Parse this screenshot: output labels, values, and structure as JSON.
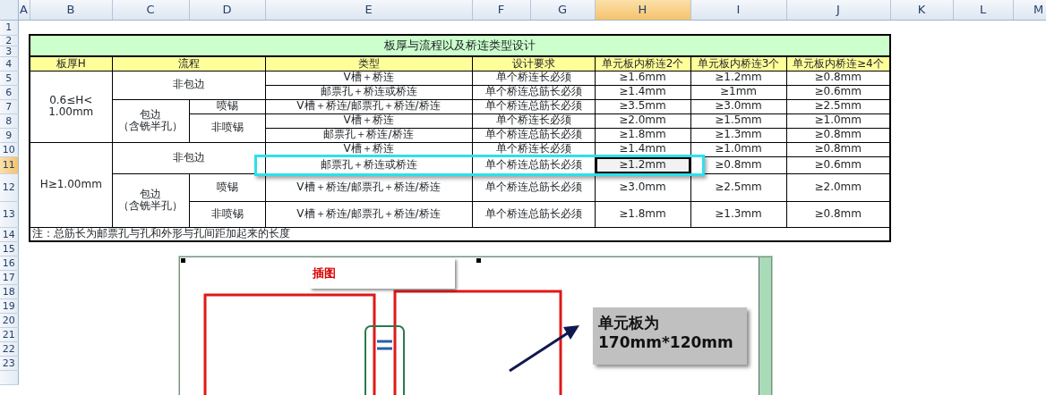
{
  "columns": [
    {
      "label": "A",
      "selected": false
    },
    {
      "label": "B",
      "selected": false
    },
    {
      "label": "C",
      "selected": false
    },
    {
      "label": "D",
      "selected": false
    },
    {
      "label": "E",
      "selected": false
    },
    {
      "label": "F",
      "selected": false
    },
    {
      "label": "G",
      "selected": false
    },
    {
      "label": "H",
      "selected": true
    },
    {
      "label": "I",
      "selected": false
    },
    {
      "label": "J",
      "selected": false
    },
    {
      "label": "K",
      "selected": false
    },
    {
      "label": "L",
      "selected": false
    },
    {
      "label": "M",
      "selected": false
    }
  ],
  "row_numbers": [
    {
      "label": "1",
      "selected": false
    },
    {
      "label": "2",
      "selected": false
    },
    {
      "label": "3",
      "selected": false
    },
    {
      "label": "4",
      "selected": false
    },
    {
      "label": "5",
      "selected": false
    },
    {
      "label": "6",
      "selected": false
    },
    {
      "label": "7",
      "selected": false
    },
    {
      "label": "8",
      "selected": false
    },
    {
      "label": "9",
      "selected": false
    },
    {
      "label": "10",
      "selected": false
    },
    {
      "label": "11",
      "selected": true
    },
    {
      "label": "12",
      "selected": false
    },
    {
      "label": "13",
      "selected": false
    },
    {
      "label": "14",
      "selected": false
    },
    {
      "label": "15",
      "selected": false
    },
    {
      "label": "16",
      "selected": false
    },
    {
      "label": "17",
      "selected": false
    },
    {
      "label": "18",
      "selected": false
    },
    {
      "label": "19",
      "selected": false
    },
    {
      "label": "20",
      "selected": false
    },
    {
      "label": "21",
      "selected": false
    },
    {
      "label": "22",
      "selected": false
    },
    {
      "label": "23",
      "selected": false
    }
  ],
  "table": {
    "title": "板厚与流程以及桥连类型设计",
    "headers": [
      "板厚H",
      "流程",
      "类型",
      "设计要求",
      "单元板内桥连2个",
      "单元板内桥连3个",
      "单元板内桥连≥4个"
    ],
    "sections": [
      {
        "thickness": "0.6≤H<\n1.00mm",
        "processes": [
          {
            "kind": "plain",
            "name": "非包边",
            "variants": [
              {
                "items": [
                  {
                    "type": "V槽＋桥连",
                    "requirement": "单个桥连长必须",
                    "values": [
                      {
                        "text": "≥1.6mm",
                        "selected": false
                      },
                      {
                        "text": "≥1.2mm",
                        "selected": false
                      },
                      {
                        "text": "≥0.8mm",
                        "selected": false
                      }
                    ]
                  },
                  {
                    "type": "邮票孔＋桥连或桥连",
                    "requirement": "单个桥连总筋长必须",
                    "values": [
                      {
                        "text": "≥1.4mm",
                        "selected": false
                      },
                      {
                        "text": "≥1mm",
                        "selected": false
                      },
                      {
                        "text": "≥0.6mm",
                        "selected": false
                      }
                    ]
                  }
                ]
              }
            ]
          },
          {
            "kind": "split",
            "name": "包边",
            "subname": "（含铣半孔）",
            "variants": [
              {
                "name": "喷锡",
                "items": [
                  {
                    "type": "V槽＋桥连/邮票孔＋桥连/桥连",
                    "requirement": "单个桥连总筋长必须",
                    "values": [
                      {
                        "text": "≥3.5mm",
                        "selected": false
                      },
                      {
                        "text": "≥3.0mm",
                        "selected": false
                      },
                      {
                        "text": "≥2.5mm",
                        "selected": false
                      }
                    ]
                  }
                ]
              },
              {
                "name": "非喷锡",
                "items": [
                  {
                    "type": "V槽＋桥连",
                    "requirement": "单个桥连长必须",
                    "values": [
                      {
                        "text": "≥2.0mm",
                        "selected": false
                      },
                      {
                        "text": "≥1.5mm",
                        "selected": false
                      },
                      {
                        "text": "≥1.0mm",
                        "selected": false
                      }
                    ]
                  },
                  {
                    "type": "邮票孔＋桥连/桥连",
                    "requirement": "单个桥连总筋长必须",
                    "values": [
                      {
                        "text": "≥1.8mm",
                        "selected": false
                      },
                      {
                        "text": "≥1.3mm",
                        "selected": false
                      },
                      {
                        "text": "≥0.8mm",
                        "selected": false
                      }
                    ]
                  }
                ]
              }
            ]
          }
        ]
      },
      {
        "thickness": "H≥1.00mm",
        "processes": [
          {
            "kind": "plain",
            "name": "非包边",
            "variants": [
              {
                "items": [
                  {
                    "type": "V槽＋桥连",
                    "requirement": "单个桥连长必须",
                    "values": [
                      {
                        "text": "≥1.4mm",
                        "selected": false
                      },
                      {
                        "text": "≥1.0mm",
                        "selected": false
                      },
                      {
                        "text": "≥0.8mm",
                        "selected": false
                      }
                    ]
                  },
                  {
                    "type": "邮票孔＋桥连或桥连",
                    "requirement": "单个桥连总筋长必须",
                    "values": [
                      {
                        "text": "≥1.2mm",
                        "selected": true
                      },
                      {
                        "text": "≥0.8mm",
                        "selected": false
                      },
                      {
                        "text": "≥0.6mm",
                        "selected": false
                      }
                    ]
                  }
                ]
              }
            ]
          },
          {
            "kind": "split",
            "name": "包边",
            "subname": "（含铣半孔）",
            "variants": [
              {
                "name": "喷锡",
                "items": [
                  {
                    "type": "V槽＋桥连/邮票孔＋桥连/桥连",
                    "requirement": "单个桥连总筋长必须",
                    "values": [
                      {
                        "text": "≥3.0mm",
                        "selected": false
                      },
                      {
                        "text": "≥2.5mm",
                        "selected": false
                      },
                      {
                        "text": "≥2.0mm",
                        "selected": false
                      }
                    ]
                  }
                ]
              },
              {
                "name": "非喷锡",
                "items": [
                  {
                    "type": "V槽＋桥连/邮票孔＋桥连/桥连",
                    "requirement": "单个桥连总筋长必须",
                    "values": [
                      {
                        "text": "≥1.8mm",
                        "selected": false
                      },
                      {
                        "text": "≥1.3mm",
                        "selected": false
                      },
                      {
                        "text": "≥0.8mm",
                        "selected": false
                      }
                    ]
                  }
                ]
              }
            ]
          }
        ]
      }
    ],
    "note": "注：总筋长为邮票孔与孔和外形与孔间距加起来的长度"
  },
  "picture": {
    "caption": "插图",
    "callout": "单元板为\n170mm*120mm"
  }
}
